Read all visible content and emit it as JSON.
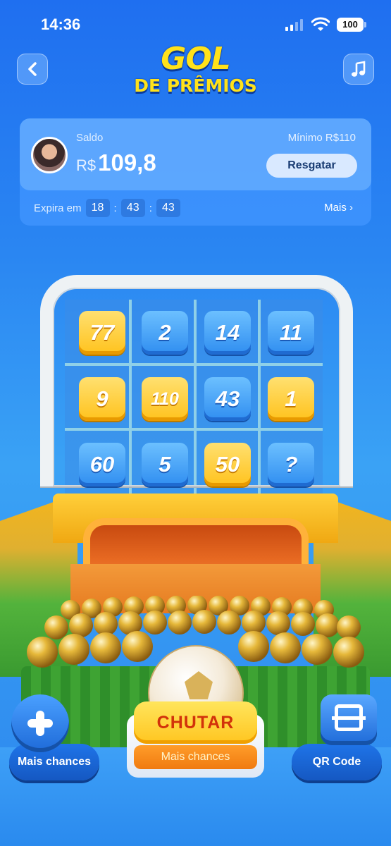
{
  "status_bar": {
    "time": "14:36",
    "battery": "100"
  },
  "header": {
    "title_line1": "GOL",
    "title_line2": "DE PRÊMIOS",
    "back_icon": "chevron-left-icon",
    "music_icon": "music-note-icon"
  },
  "balance": {
    "label": "Saldo",
    "currency": "R$",
    "amount": "109,8",
    "minimum_label": "Mínimo  R$110",
    "redeem_button": "Resgatar",
    "expires_label": "Expira em",
    "timer": [
      "18",
      "43",
      "43"
    ],
    "more_link": "Mais ›"
  },
  "board": {
    "tiles": [
      {
        "value": "77",
        "color": "gold"
      },
      {
        "value": "2",
        "color": "blue"
      },
      {
        "value": "14",
        "color": "blue"
      },
      {
        "value": "11",
        "color": "blue"
      },
      {
        "value": "9",
        "color": "gold"
      },
      {
        "value": "110",
        "color": "gold"
      },
      {
        "value": "43",
        "color": "blue"
      },
      {
        "value": "1",
        "color": "gold"
      },
      {
        "value": "60",
        "color": "blue"
      },
      {
        "value": "5",
        "color": "blue"
      },
      {
        "value": "50",
        "color": "gold"
      },
      {
        "value": "?",
        "color": "blue"
      }
    ]
  },
  "actions": {
    "more_chances": "Mais chances",
    "kick_button": "CHUTAR",
    "kick_sub": "Mais chances",
    "qr_code": "QR Code"
  }
}
